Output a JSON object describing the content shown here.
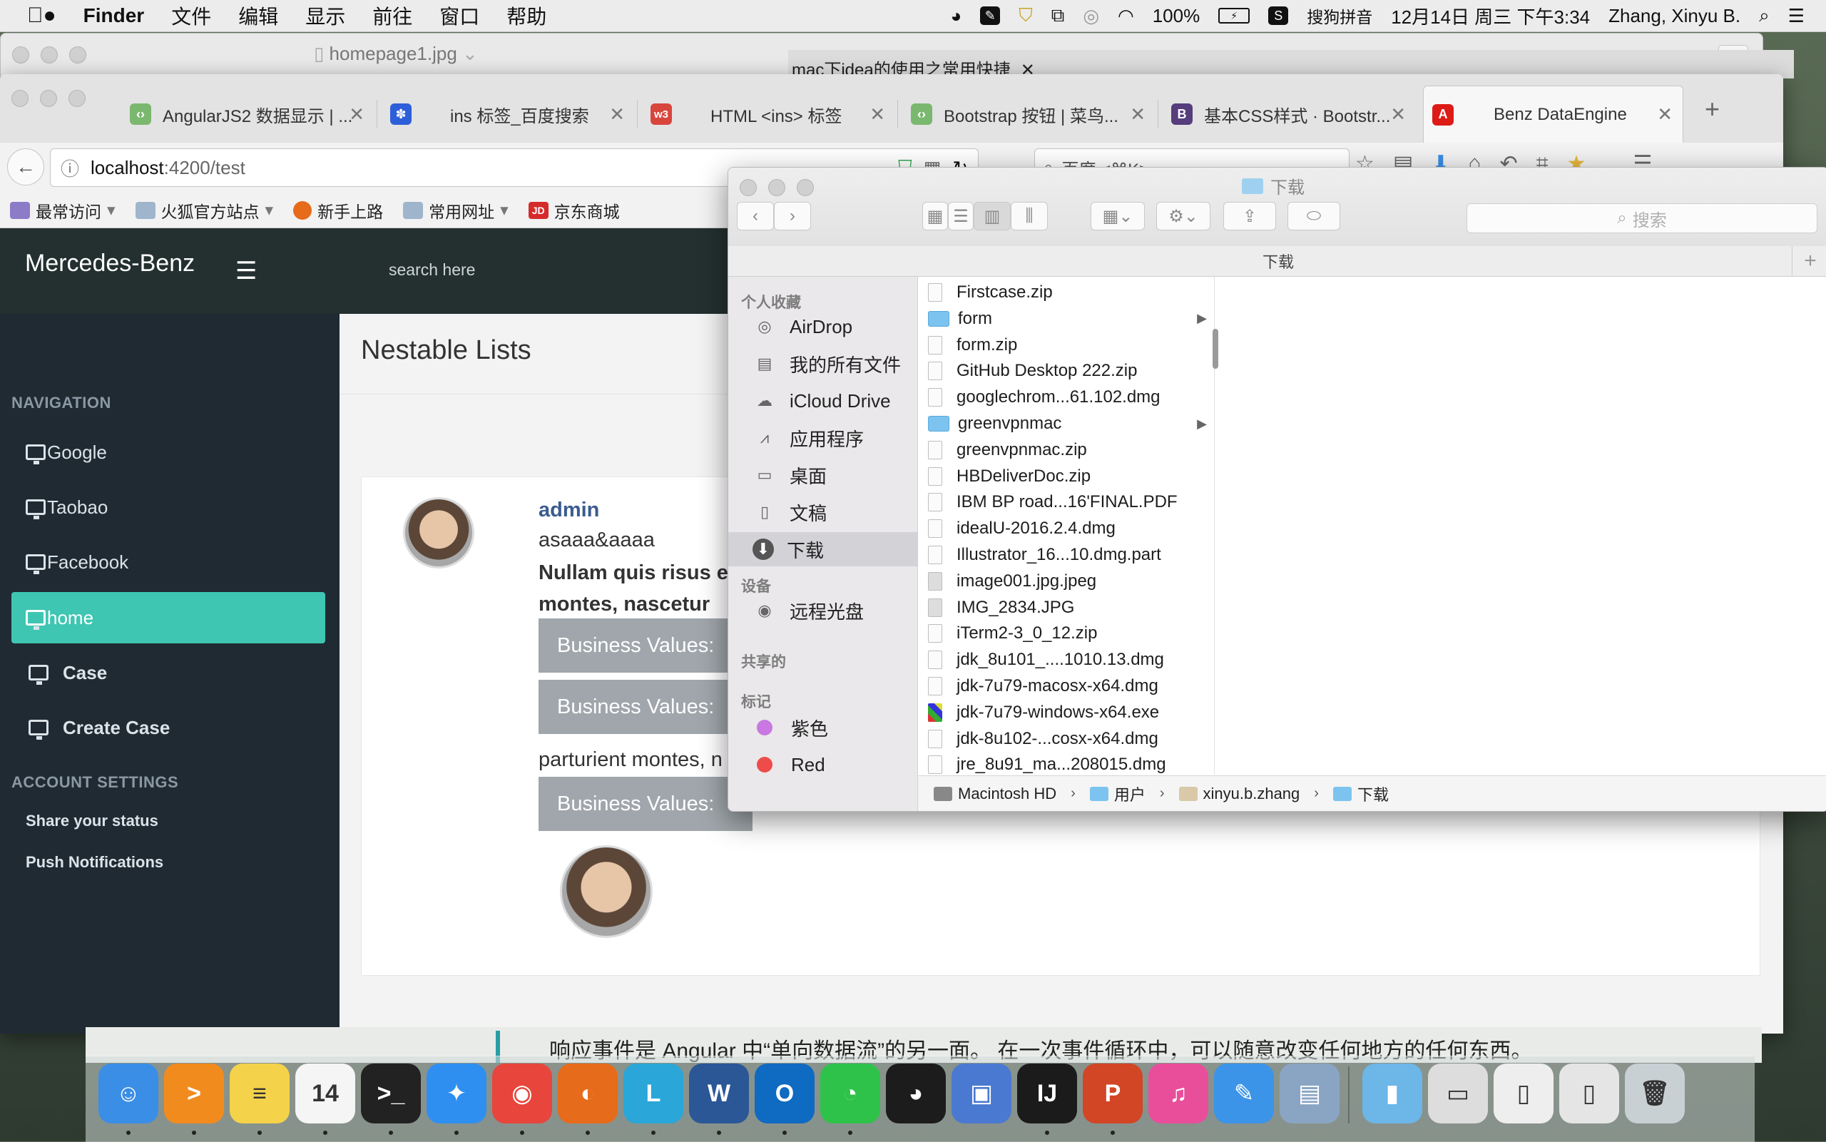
{
  "menubar": {
    "app_name": "Finder",
    "menus": [
      "文件",
      "编辑",
      "显示",
      "前往",
      "窗口",
      "帮助"
    ],
    "battery": "100%",
    "input_method": "搜狗拼音",
    "datetime": "12月14日 周三 下午3:34",
    "user": "Zhang, Xinyu B."
  },
  "back_windows": {
    "preview_title": "homepage1.jpg",
    "tab_title": "mac下idea的使用之常用快捷"
  },
  "browser": {
    "tabs": [
      {
        "label": "AngularJS2 数据显示 | ...",
        "icon": "runoob-icon",
        "color": "#7bb86f"
      },
      {
        "label": "ins 标签_百度搜索",
        "icon": "baidu-paw-icon",
        "color": "#2d5fd8"
      },
      {
        "label": "HTML <ins> 标签",
        "icon": "w3-icon",
        "color": "#d8453d"
      },
      {
        "label": "Bootstrap 按钮 | 菜鸟...",
        "icon": "runoob-icon",
        "color": "#7bb86f"
      },
      {
        "label": "基本CSS样式 · Bootstr...",
        "icon": "bootstrap-icon",
        "color": "#563d7c"
      },
      {
        "label": "Benz DataEngine",
        "icon": "angular-icon",
        "color": "#dd1b16"
      }
    ],
    "url_host": "localhost",
    "url_rest": ":4200/test",
    "search_placeholder": "百度 <⌘K>",
    "bookmarks": [
      "最常访问",
      "火狐官方站点",
      "新手上路",
      "常用网址",
      "京东商城"
    ]
  },
  "app": {
    "brand": "Mercedes-Benz",
    "search_placeholder": "search here",
    "nav_header": "NAVIGATION",
    "nav_items": [
      "Google",
      "Taobao",
      "Facebook",
      "home",
      "Case",
      "Create Case"
    ],
    "account_header": "ACCOUNT SETTINGS",
    "account_items": [
      "Share your status",
      "Push Notifications"
    ],
    "page_title": "Nestable Lists",
    "comment": {
      "name": "admin",
      "subtitle": "asaaa&aaaa",
      "bold_line1": "Nullam quis risus e",
      "bold_line2": "montes, nascetur",
      "button_label": "Business Values:",
      "mid_text": "parturient montes, n"
    }
  },
  "underlying_doc": {
    "text": "响应事件是 Angular 中“单向数据流”的另一面。 在一次事件循环中，可以随意改变任何地方的任何东西。"
  },
  "finder": {
    "title": "下载",
    "path_title": "下载",
    "search_placeholder": "搜索",
    "favorites_header": "个人收藏",
    "favorites": [
      {
        "label": "AirDrop",
        "icon": "airdrop-icon"
      },
      {
        "label": "我的所有文件",
        "icon": "all-files-icon"
      },
      {
        "label": "iCloud Drive",
        "icon": "icloud-icon"
      },
      {
        "label": "应用程序",
        "icon": "applications-icon"
      },
      {
        "label": "桌面",
        "icon": "desktop-icon"
      },
      {
        "label": "文稿",
        "icon": "documents-icon"
      },
      {
        "label": "下载",
        "icon": "downloads-icon"
      }
    ],
    "devices_header": "设备",
    "devices": [
      {
        "label": "远程光盘",
        "icon": "disc-icon"
      }
    ],
    "shared_header": "共享的",
    "tags_header": "标记",
    "tags": [
      {
        "label": "紫色",
        "color": "#c878e0"
      },
      {
        "label": "Red",
        "color": "#ee4b4b"
      }
    ],
    "files": [
      {
        "name": "Firstcase.zip",
        "kind": "zip"
      },
      {
        "name": "form",
        "kind": "folder"
      },
      {
        "name": "form.zip",
        "kind": "zip"
      },
      {
        "name": "GitHub Desktop 222.zip",
        "kind": "zip"
      },
      {
        "name": "googlechrom...61.102.dmg",
        "kind": "dmg"
      },
      {
        "name": "greenvpnmac",
        "kind": "folder"
      },
      {
        "name": "greenvpnmac.zip",
        "kind": "zip"
      },
      {
        "name": "HBDeliverDoc.zip",
        "kind": "zip"
      },
      {
        "name": "IBM BP road...16'FINAL.PDF",
        "kind": "pdf"
      },
      {
        "name": "idealU-2016.2.4.dmg",
        "kind": "dmg"
      },
      {
        "name": "Illustrator_16...10.dmg.part",
        "kind": "part"
      },
      {
        "name": "image001.jpg.jpeg",
        "kind": "img"
      },
      {
        "name": "IMG_2834.JPG",
        "kind": "img"
      },
      {
        "name": "iTerm2-3_0_12.zip",
        "kind": "zip"
      },
      {
        "name": "jdk_8u101_....1010.13.dmg",
        "kind": "dmg"
      },
      {
        "name": "jdk-7u79-macosx-x64.dmg",
        "kind": "dmg"
      },
      {
        "name": "jdk-7u79-windows-x64.exe",
        "kind": "exe"
      },
      {
        "name": "jdk-8u102-...cosx-x64.dmg",
        "kind": "dmg"
      },
      {
        "name": "jre_8u91_ma...208015.dmg",
        "kind": "dmg"
      }
    ],
    "breadcrumb": [
      "Macintosh HD",
      "用户",
      "xinyu.b.zhang",
      "下载"
    ]
  },
  "dock": {
    "apps": [
      {
        "name": "finder-icon",
        "color": "#3a8ee6",
        "glyph": "☺"
      },
      {
        "name": "infuse-icon",
        "color": "#f28b1e",
        "glyph": ">"
      },
      {
        "name": "notes-icon",
        "color": "#f4d24a",
        "glyph": "≡"
      },
      {
        "name": "calendar-icon",
        "color": "#f5f5f5",
        "glyph": "14"
      },
      {
        "name": "terminal-icon",
        "color": "#222222",
        "glyph": ">_"
      },
      {
        "name": "safari-icon",
        "color": "#2f8ff0",
        "glyph": "✦"
      },
      {
        "name": "chrome-icon",
        "color": "#e8453c",
        "glyph": "◉"
      },
      {
        "name": "firefox-icon",
        "color": "#e66b1a",
        "glyph": "◐"
      },
      {
        "name": "lync-icon",
        "color": "#2aa6d8",
        "glyph": "L"
      },
      {
        "name": "word-icon",
        "color": "#2b5797",
        "glyph": "W"
      },
      {
        "name": "outlook-icon",
        "color": "#0f6ac1",
        "glyph": "O"
      },
      {
        "name": "wechat-icon",
        "color": "#2fc24b",
        "glyph": "◔"
      },
      {
        "name": "qq-icon",
        "color": "#1c1c1c",
        "glyph": "◕"
      },
      {
        "name": "vmware-icon",
        "color": "#4a79d1",
        "glyph": "▣"
      },
      {
        "name": "intellij-icon",
        "color": "#1b1b1b",
        "glyph": "IJ"
      },
      {
        "name": "powerpoint-icon",
        "color": "#d24625",
        "glyph": "P"
      },
      {
        "name": "itunes-icon",
        "color": "#e94e9b",
        "glyph": "♫"
      },
      {
        "name": "pages-icon",
        "color": "#3b94e8",
        "glyph": "✎"
      },
      {
        "name": "preview-icon",
        "color": "#8aa5c4",
        "glyph": "▤"
      },
      {
        "name": "downloads-folder-icon",
        "color": "#6cb6e8",
        "glyph": "▮"
      },
      {
        "name": "window-thumbnail-icon",
        "color": "#dddddd",
        "glyph": "▭"
      },
      {
        "name": "document-thumbnail-icon",
        "color": "#eeeeee",
        "glyph": "▯"
      },
      {
        "name": "document-thumbnail-icon-2",
        "color": "#e5e5e5",
        "glyph": "▯"
      },
      {
        "name": "trash-icon",
        "color": "#c9d0d4",
        "glyph": "🗑"
      }
    ]
  }
}
